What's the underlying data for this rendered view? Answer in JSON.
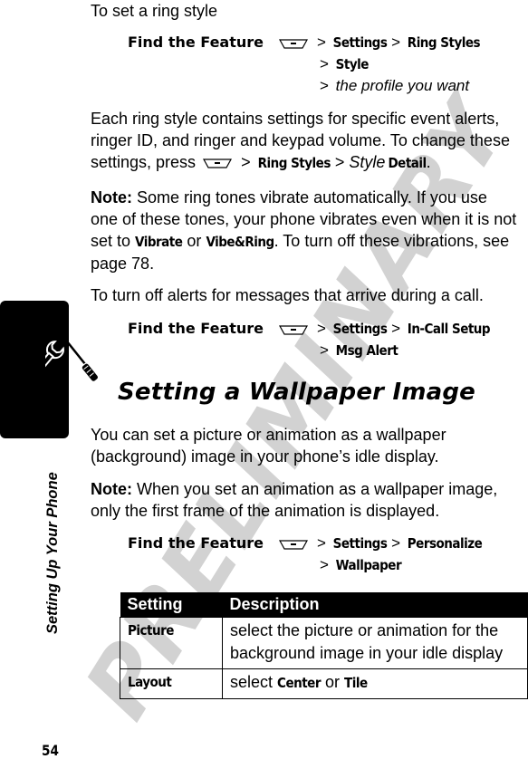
{
  "watermark": "PRELIMINARY",
  "section_tab": {
    "icon": "tools-wrench-screwdriver-icon",
    "title": "Setting Up Your Phone"
  },
  "page_number": "54",
  "intro_ring_style": "To set a ring style",
  "find_feature_1": {
    "label": "Find the Feature",
    "key_icon": "menu-key-icon",
    "path_lines": [
      [
        {
          "sep": ">",
          "text": "Settings",
          "style": "menu"
        },
        {
          "sep": ">",
          "text": "Ring Styles",
          "style": "menu"
        }
      ],
      [
        {
          "sep": ">",
          "text": "Style",
          "style": "menu"
        }
      ],
      [
        {
          "sep": ">",
          "text": "the profile you want",
          "style": "italic"
        }
      ]
    ]
  },
  "para_ring_style": {
    "line1": "Each ring style contains settings for specific event alerts,",
    "line2": "ringer ID, and ringer and keypad volume. To change these",
    "line3_prefix": "settings, press",
    "line3_gt1": ">",
    "line3_menu1": "Ring Styles",
    "line3_gt2": ">",
    "line3_italic": "Style",
    "line3_menu2": "Detail",
    "line3_end": "."
  },
  "note_vibrate": {
    "label": "Note:",
    "line1": "Some ring tones vibrate automatically. If you use",
    "line2": "one of these tones, your phone vibrates even when it is not",
    "line3_prefix": "set to",
    "menu1": "Vibrate",
    "or": "or",
    "menu2": "Vibe&Ring",
    "line3_suffix": ". To turn off these vibrations, see",
    "line4": "page 78."
  },
  "intro_msg_alert": "To turn off alerts for messages that arrive during a call.",
  "find_feature_2": {
    "label": "Find the Feature",
    "key_icon": "menu-key-icon",
    "line1": [
      {
        "sep": ">",
        "text": "Settings"
      },
      {
        "sep": ">",
        "text": "In-Call Setup"
      }
    ],
    "line2": [
      {
        "sep": ">",
        "text": "Msg Alert"
      }
    ]
  },
  "heading_wallpaper": "Setting a Wallpaper Image",
  "para_wallpaper": {
    "line1": "You can set a picture or animation as a wallpaper",
    "line2": "(background) image in your phone’s idle display."
  },
  "note_wallpaper": {
    "label": "Note:",
    "line1": "When you set an animation as a wallpaper image,",
    "line2": "only the first frame of the animation is displayed."
  },
  "find_feature_3": {
    "label": "Find the Feature",
    "key_icon": "menu-key-icon",
    "line1": [
      {
        "sep": ">",
        "text": "Settings"
      },
      {
        "sep": ">",
        "text": "Personalize"
      }
    ],
    "line2": [
      {
        "sep": ">",
        "text": "Wallpaper"
      }
    ]
  },
  "table": {
    "headers": [
      "Setting",
      "Description"
    ],
    "rows": [
      {
        "setting": "Picture",
        "desc_line1": "select the picture or animation for the",
        "desc_line2": "background image in your idle display"
      },
      {
        "setting": "Layout",
        "desc_prefix": "select",
        "opt1": "Center",
        "or": "or",
        "opt2": "Tile"
      }
    ]
  }
}
